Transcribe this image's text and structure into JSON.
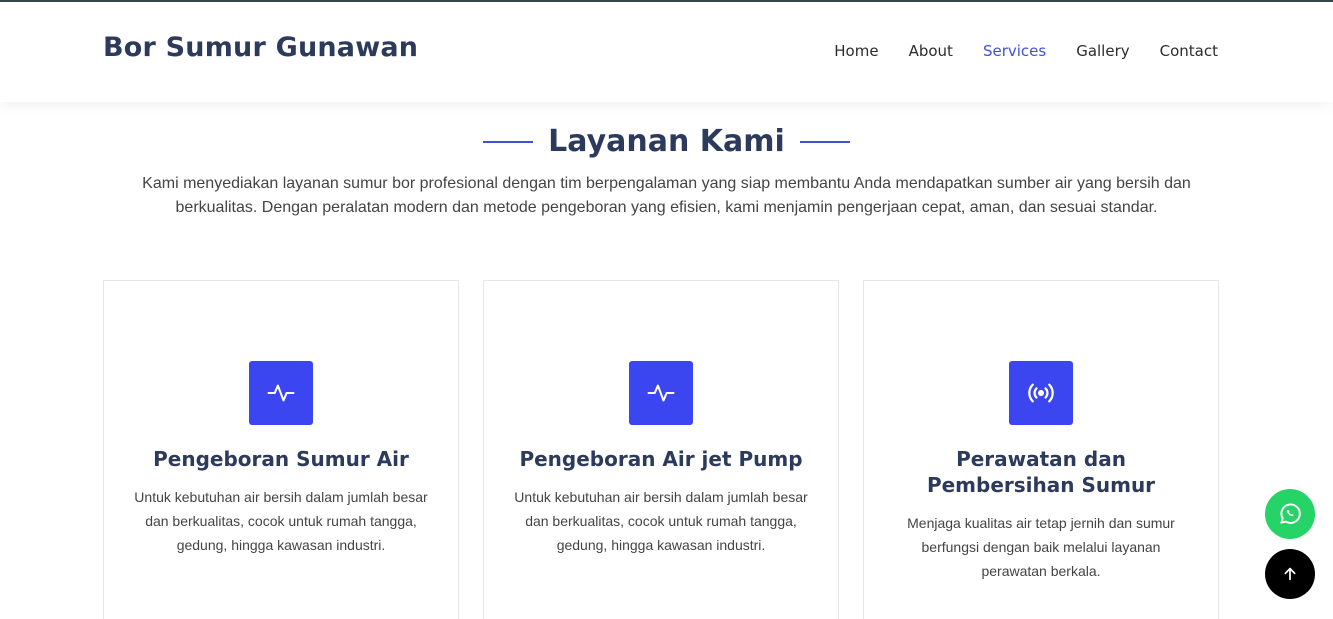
{
  "header": {
    "logo": "Bor Sumur Gunawan",
    "nav": [
      {
        "label": "Home",
        "active": false
      },
      {
        "label": "About",
        "active": false
      },
      {
        "label": "Services",
        "active": true
      },
      {
        "label": "Gallery",
        "active": false
      },
      {
        "label": "Contact",
        "active": false
      }
    ],
    "accent_color": "#3f50d6"
  },
  "services": {
    "title": "Layanan Kami",
    "description": "Kami menyediakan layanan sumur bor profesional dengan tim berpengalaman yang siap membantu Anda mendapatkan sumber air yang bersih dan berkualitas. Dengan peralatan modern dan metode pengeboran yang efisien, kami menjamin pengerjaan cepat, aman, dan sesuai standar.",
    "cards": [
      {
        "icon": "activity-icon",
        "title": "Pengeboran Sumur Air",
        "text": "Untuk kebutuhan air bersih dalam jumlah besar dan berkualitas, cocok untuk rumah tangga, gedung, hingga kawasan industri."
      },
      {
        "icon": "activity-icon",
        "title": "Pengeboran Air jet Pump",
        "text": "Untuk kebutuhan air bersih dalam jumlah besar dan berkualitas, cocok untuk rumah tangga, gedung, hingga kawasan industri."
      },
      {
        "icon": "broadcast-icon",
        "title": "Perawatan dan Pembersihan Sumur",
        "text": "Menjaga kualitas air tetap jernih dan sumur berfungsi dengan baik melalui layanan perawatan berkala."
      }
    ],
    "icon_bg_color": "#3b46f0"
  },
  "floating": {
    "whatsapp_icon": "whatsapp-icon",
    "whatsapp_color": "#25d366",
    "back_to_top_icon": "arrow-up-icon",
    "back_to_top_color": "#000000"
  }
}
